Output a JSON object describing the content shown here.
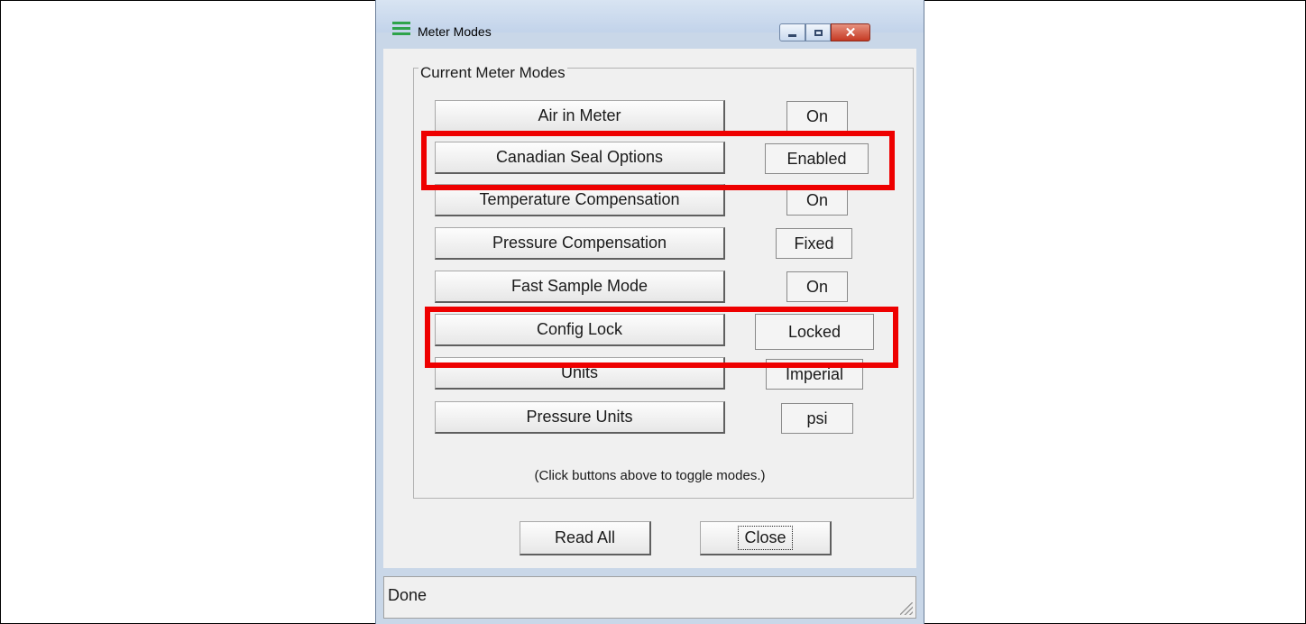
{
  "window": {
    "title": "Meter Modes"
  },
  "group": {
    "label": "Current Meter Modes"
  },
  "modes": [
    {
      "label": "Air in Meter",
      "value": "On"
    },
    {
      "label": "Canadian Seal Options",
      "value": "Enabled"
    },
    {
      "label": "Temperature Compensation",
      "value": "On"
    },
    {
      "label": "Pressure Compensation",
      "value": "Fixed"
    },
    {
      "label": "Fast Sample Mode",
      "value": "On"
    },
    {
      "label": "Config Lock",
      "value": "Locked"
    },
    {
      "label": "Units",
      "value": "Imperial"
    },
    {
      "label": "Pressure Units",
      "value": "psi"
    }
  ],
  "hint": "(Click buttons above to toggle modes.)",
  "buttons": {
    "read_all": "Read All",
    "close": "Close"
  },
  "status": "Done",
  "colors": {
    "highlight": "#ee0000",
    "title_gradient_top": "#d8e4f2",
    "close_button": "#c53a23"
  }
}
